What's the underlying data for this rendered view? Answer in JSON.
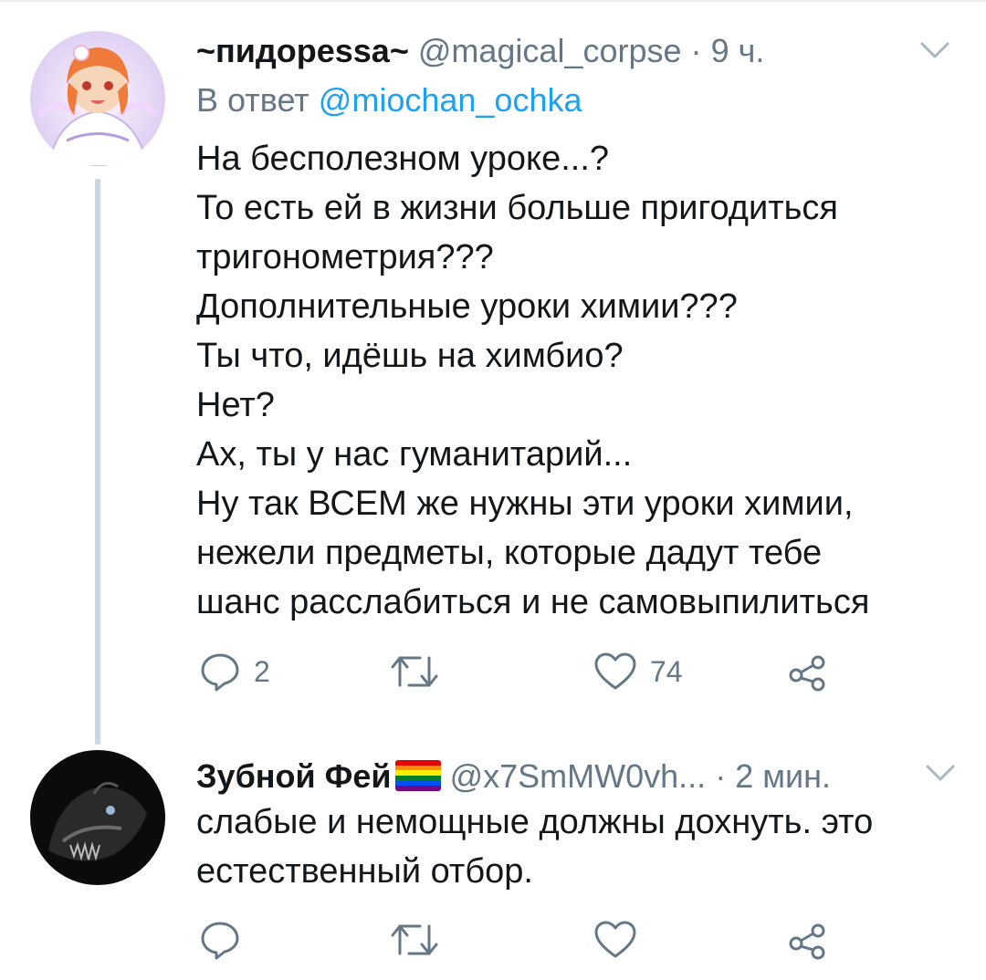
{
  "tweets": [
    {
      "display_name": "~пидорessa~",
      "handle": "@magical_corpse",
      "separator": "·",
      "time": "9 ч.",
      "reply_prefix": "В ответ",
      "reply_mention": "@miochan_ochka",
      "text_lines": [
        "На бесполезном уроке...?",
        "То есть ей в жизни больше пригодиться",
        "тригонометрия???",
        "Дополнительные уроки химии???",
        "Ты что, идёшь на химбио?",
        "Нет?",
        "Ах, ты у нас гуманитарий...",
        "Ну так ВСЕМ же нужны эти уроки химии,",
        "нежели предметы, которые дадут тебе",
        "шанс расслабиться и не самовыпилиться"
      ],
      "actions": {
        "reply_count": "2",
        "retweet_count": "",
        "like_count": "74"
      },
      "icons": [
        "anime-avatar",
        "chevron-down-icon",
        "reply-icon",
        "retweet-icon",
        "like-icon",
        "share-icon"
      ]
    },
    {
      "display_name": "Зубной Фей",
      "name_emoji": "rainbow-flag",
      "handle": "@x7SmMW0vh...",
      "separator": "·",
      "time": "2 мин.",
      "text_lines": [
        "слабые и немощные должны дохнуть. это",
        "естественный отбор."
      ],
      "actions": {
        "reply_count": "",
        "retweet_count": "",
        "like_count": ""
      },
      "icons": [
        "creature-avatar",
        "chevron-down-icon",
        "reply-icon",
        "retweet-icon",
        "like-icon",
        "share-icon"
      ]
    }
  ],
  "colors": {
    "text_primary": "#14171a",
    "text_secondary": "#657786",
    "link": "#1da1f2",
    "thread_line": "#ccd6dd",
    "rainbow": [
      "#e40303",
      "#ff8c00",
      "#ffed00",
      "#008026",
      "#004dff",
      "#750787"
    ]
  }
}
